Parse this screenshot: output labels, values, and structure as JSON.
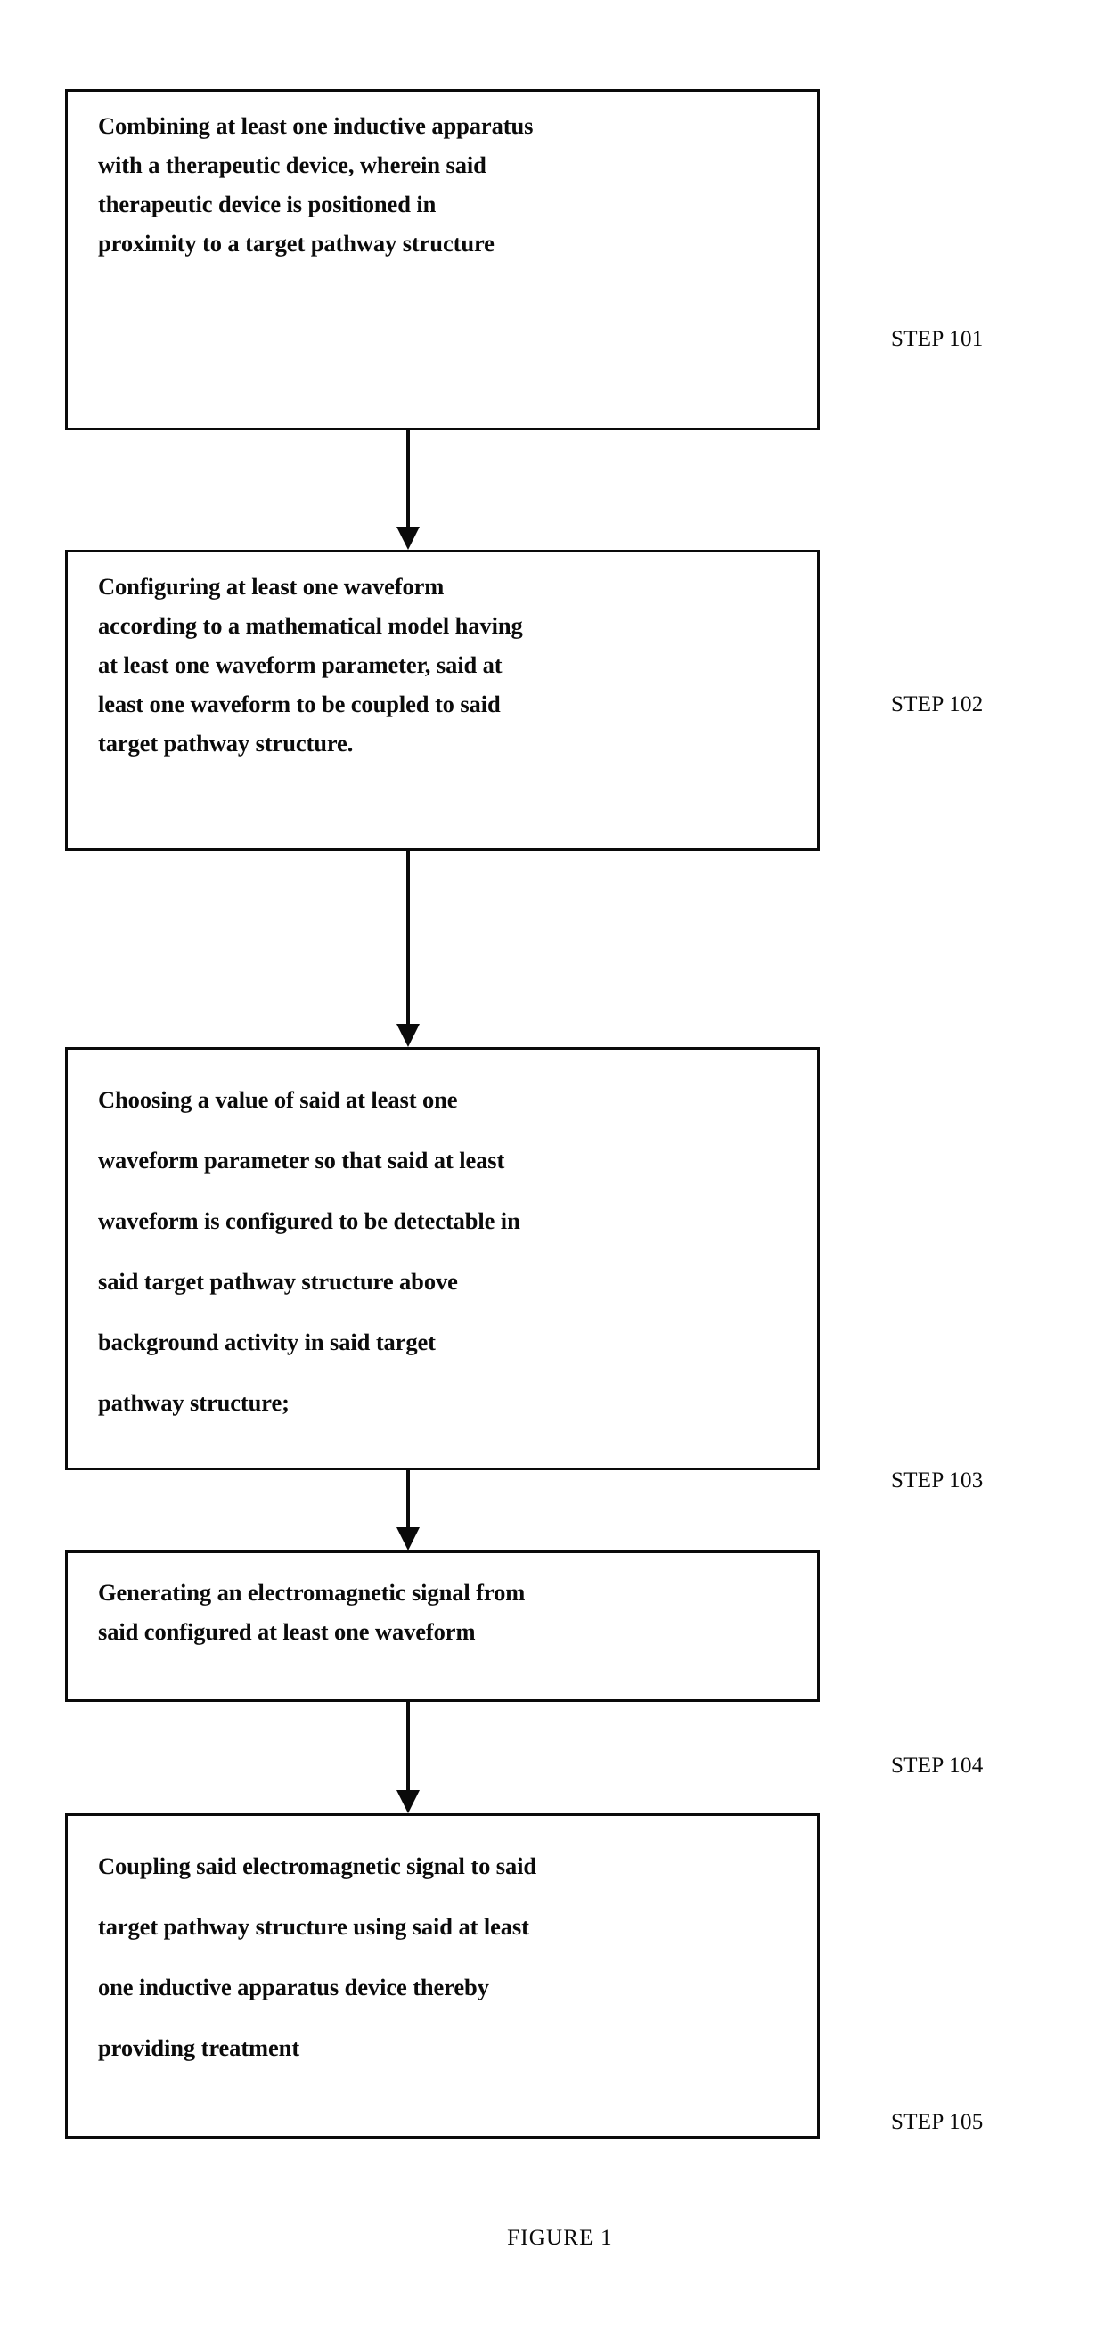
{
  "figure": {
    "caption": "FIGURE 1"
  },
  "steps": [
    {
      "id": "step-101",
      "text": "Combining at least one inductive apparatus\nwith a therapeutic device, wherein said\ntherapeutic device is positioned in\nproximity to a target pathway structure",
      "label": "STEP 101",
      "spacing": "tight"
    },
    {
      "id": "step-102",
      "text": "Configuring at least one waveform\naccording to a mathematical model having\nat least one waveform parameter, said at\nleast one waveform to be coupled to said\ntarget pathway structure.",
      "label": "STEP 102",
      "spacing": "tight"
    },
    {
      "id": "step-103",
      "text": "Choosing a value of said at least one\nwaveform parameter so that said at least\nwaveform is configured to be  detectable in\nsaid target pathway structure above\nbackground activity in  said target\npathway structure;",
      "label": "STEP 103",
      "spacing": "loose"
    },
    {
      "id": "step-104",
      "text": "Generating an electromagnetic signal from\nsaid configured at least one waveform",
      "label": "STEP 104",
      "spacing": "tight"
    },
    {
      "id": "step-105",
      "text": "Coupling said electromagnetic signal to said\ntarget pathway structure using said at least\none inductive apparatus device thereby\nproviding treatment",
      "label": "STEP 105",
      "spacing": "loose"
    }
  ],
  "connectors": [
    {
      "id": "connector-1-2",
      "from": "step-101",
      "to": "step-102"
    },
    {
      "id": "connector-2-3",
      "from": "step-102",
      "to": "step-103"
    },
    {
      "id": "connector-3-4",
      "from": "step-103",
      "to": "step-104"
    },
    {
      "id": "connector-4-5",
      "from": "step-104",
      "to": "step-105"
    }
  ]
}
